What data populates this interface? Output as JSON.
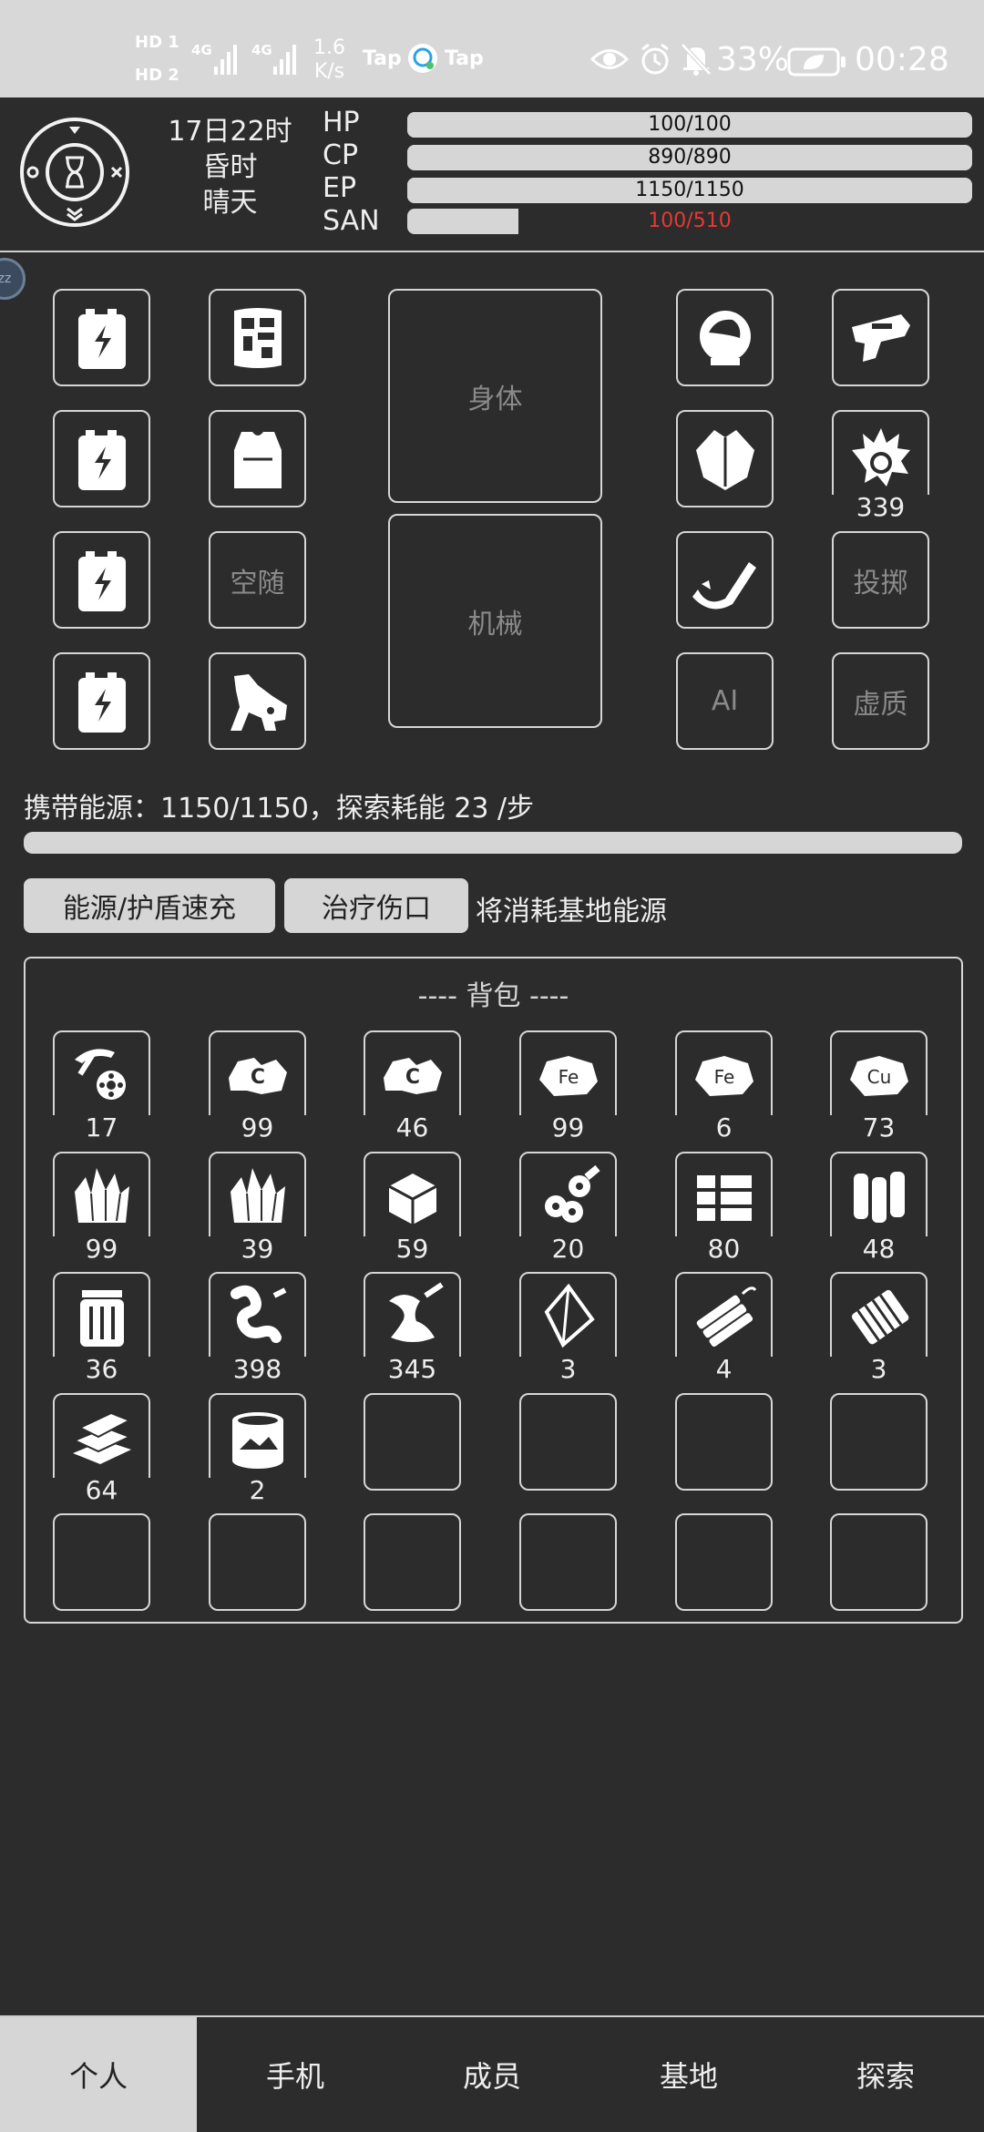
{
  "status_bar": {
    "sim1": "HD 1",
    "sim2": "HD 2",
    "net1": "4G",
    "net2": "4G",
    "speed_value": "1.6",
    "speed_unit": "K/s",
    "app1": "Tap",
    "app2": "Tap",
    "battery": "33%",
    "time": "00:28"
  },
  "header": {
    "day_hour": "17日22时",
    "period": "昏时",
    "weather": "晴天",
    "stats": [
      {
        "label": "HP",
        "value": "100/100",
        "fill": 1.0
      },
      {
        "label": "CP",
        "value": "890/890",
        "fill": 1.0
      },
      {
        "label": "EP",
        "value": "1150/1150",
        "fill": 1.0
      },
      {
        "label": "SAN",
        "value": "100/510",
        "fill": 0.196
      }
    ],
    "bubble": "zz"
  },
  "equipment": {
    "body_label": "身体",
    "mech_label": "机械",
    "slot_empty_labels": {
      "kongsui": "空随",
      "throw": "投掷",
      "ai": "AI",
      "void": "虚质"
    },
    "blast_count": "339"
  },
  "energy": {
    "line": "携带能源：1150/1150，探索耗能 23 /步",
    "fill": 1.0
  },
  "actions": {
    "recharge_label": "能源/护盾速充",
    "heal_label": "治疗伤口",
    "note": "将消耗基地能源"
  },
  "backpack": {
    "title": "---- 背包 ----",
    "items": [
      {
        "icon": "pickaxe-wheel-icon",
        "count": "17"
      },
      {
        "icon": "carbon-ore-icon",
        "count": "99"
      },
      {
        "icon": "carbon-ore-icon",
        "count": "46"
      },
      {
        "icon": "iron-ore-icon",
        "count": "99"
      },
      {
        "icon": "iron-ore-icon",
        "count": "6"
      },
      {
        "icon": "copper-ore-icon",
        "count": "73"
      },
      {
        "icon": "crystal-icon",
        "count": "99"
      },
      {
        "icon": "crystal-icon",
        "count": "39"
      },
      {
        "icon": "cube-icon",
        "count": "59"
      },
      {
        "icon": "pipes-icon",
        "count": "20"
      },
      {
        "icon": "ingots-icon",
        "count": "80"
      },
      {
        "icon": "rolls-icon",
        "count": "48"
      },
      {
        "icon": "canister-icon",
        "count": "36"
      },
      {
        "icon": "spring-icon",
        "count": "398"
      },
      {
        "icon": "molten-icon",
        "count": "345"
      },
      {
        "icon": "diamond-icon",
        "count": "3"
      },
      {
        "icon": "dynamite-icon",
        "count": "4"
      },
      {
        "icon": "crate-icon",
        "count": "3"
      },
      {
        "icon": "plates-icon",
        "count": "64"
      },
      {
        "icon": "drum-icon",
        "count": "2"
      },
      {
        "icon": "",
        "count": ""
      },
      {
        "icon": "",
        "count": ""
      },
      {
        "icon": "",
        "count": ""
      },
      {
        "icon": "",
        "count": ""
      },
      {
        "icon": "",
        "count": ""
      },
      {
        "icon": "",
        "count": ""
      },
      {
        "icon": "",
        "count": ""
      },
      {
        "icon": "",
        "count": ""
      },
      {
        "icon": "",
        "count": ""
      },
      {
        "icon": "",
        "count": ""
      }
    ]
  },
  "nav": {
    "tabs": [
      "个人",
      "手机",
      "成员",
      "基地",
      "探索"
    ],
    "active": 0
  },
  "colors": {
    "background": "#2c2c2c",
    "bar": "#d6d6d6",
    "san_text": "#e53935",
    "muted_label": "#8a8a8a"
  }
}
